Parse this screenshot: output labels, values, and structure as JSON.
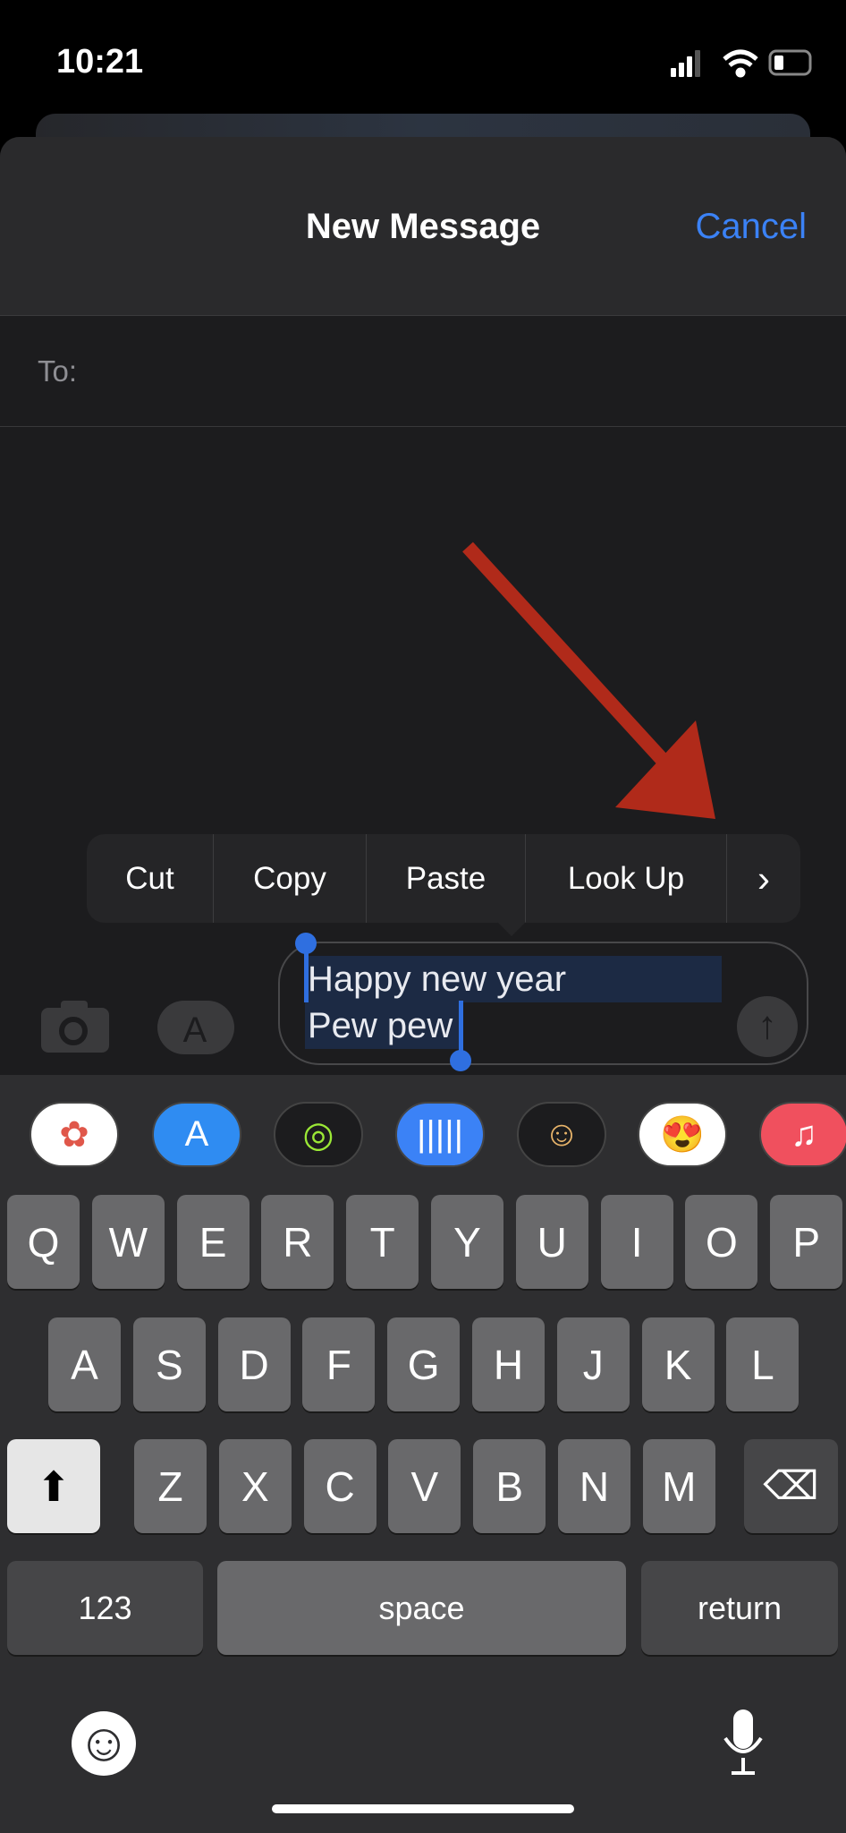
{
  "status": {
    "time": "10:21",
    "signal": "signal-icon",
    "wifi": "wifi-icon",
    "battery": "battery-icon"
  },
  "header": {
    "title": "New Message",
    "cancel": "Cancel"
  },
  "to": {
    "label": "To:"
  },
  "menu": {
    "items": [
      "Cut",
      "Copy",
      "Paste",
      "Look Up"
    ],
    "more": "›"
  },
  "compose": {
    "lines": [
      "Happy new year",
      "Pew pew"
    ],
    "send": "↑"
  },
  "apps": [
    {
      "name": "photos",
      "bg": "#ffffff",
      "glyph": "✿",
      "color": "#e0574a"
    },
    {
      "name": "app-store",
      "bg": "#2f8cf2",
      "glyph": "A",
      "color": "#ffffff"
    },
    {
      "name": "activity",
      "bg": "#1c1c1e",
      "glyph": "◎",
      "color": "#9be836"
    },
    {
      "name": "audio",
      "bg": "#3b82f6",
      "glyph": "|||||",
      "color": "#ffffff"
    },
    {
      "name": "memoji",
      "bg": "#1c1c1e",
      "glyph": "☺",
      "color": "#e8b46a"
    },
    {
      "name": "memoji-stickers",
      "bg": "#ffffff",
      "glyph": "😍",
      "color": "#000"
    },
    {
      "name": "music",
      "bg": "#f0505e",
      "glyph": "♫",
      "color": "#ffffff"
    }
  ],
  "keyboard": {
    "row1": [
      "Q",
      "W",
      "E",
      "R",
      "T",
      "Y",
      "U",
      "I",
      "O",
      "P"
    ],
    "row2": [
      "A",
      "S",
      "D",
      "F",
      "G",
      "H",
      "J",
      "K",
      "L"
    ],
    "row3": [
      "Z",
      "X",
      "C",
      "V",
      "B",
      "N",
      "M"
    ],
    "shift": "⬆",
    "delete": "⌫",
    "numbers": "123",
    "space": "space",
    "return": "return",
    "emoji": "☺",
    "mic": "🎙"
  },
  "colors": {
    "accent": "#3b82f6",
    "annotation_arrow": "#b02a1a"
  }
}
